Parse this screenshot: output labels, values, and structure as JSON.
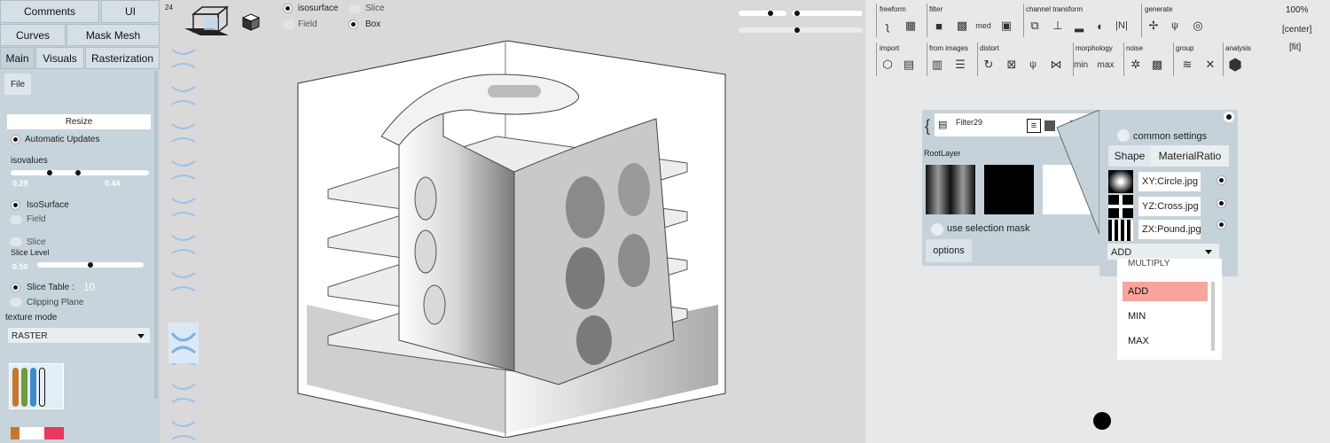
{
  "left_panel": {
    "top_tabs": [
      "Comments",
      "UI",
      "Curves",
      "Mask Mesh"
    ],
    "main_tabs": [
      "Main",
      "Visuals",
      "Rasterization"
    ],
    "file_button": "File",
    "resize_button": "Resize",
    "auto_updates": "Automatic Updates",
    "isovalues_label": "isovalues",
    "isovalue_low": "0.29",
    "isovalue_high": "0.44",
    "isosurface": "IsoSurface",
    "field": "Field",
    "slice": "Slice",
    "slice_level_label": "Slice Level",
    "slice_level": "0.50",
    "slice_table": "Slice Table :",
    "slice_table_value": "10",
    "clipping_plane": "Clipping Plane",
    "texture_mode_label": "texture mode",
    "texture_mode_value": "RASTER"
  },
  "viewport": {
    "frame_number": "24",
    "toggles": {
      "isosurface": "isosurface",
      "slice": "Slice",
      "field": "Field",
      "box": "Box"
    }
  },
  "toolbar": {
    "categories": [
      "freeform",
      "filter",
      "channel transform",
      "generate",
      "import",
      "from images",
      "distort",
      "morphology",
      "noise",
      "group",
      "analysis"
    ],
    "med_label": "med",
    "min_label": "min",
    "max_label": "max",
    "zoom": "100%",
    "center": "[center]",
    "fit": "[fit]"
  },
  "filter_node": {
    "name": "Filter29",
    "root_layer": "RootLayer",
    "use_selection_mask": "use selection mask",
    "options": "options",
    "common_settings": "common settings",
    "tabs": [
      "Shape",
      "MaterialRatio"
    ],
    "images": [
      "XY:Circle.jpg",
      "YZ:Cross.jpg",
      "ZX:Pound.jpg"
    ],
    "blend_mode": "ADD",
    "blend_options": [
      "MULTIPLY",
      "ADD",
      "MIN",
      "MAX"
    ],
    "highlight_color": "#f7a59c"
  }
}
